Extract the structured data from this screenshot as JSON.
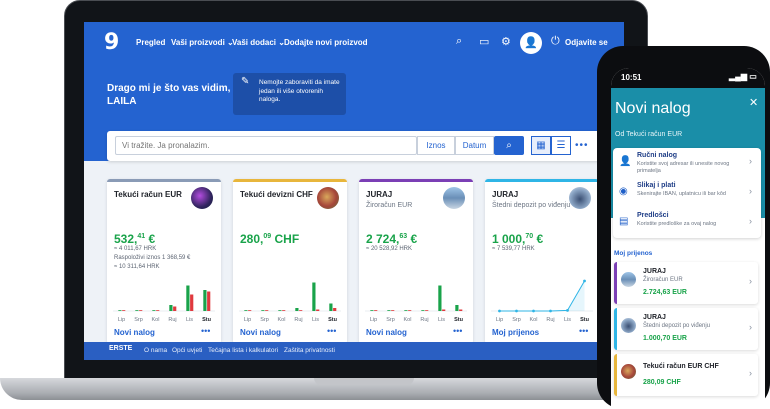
{
  "colors": {
    "brand_blue": "#2463d0",
    "green": "#19a34a",
    "phone_accent": "#1a8ea8",
    "red": "#e0393e"
  },
  "nav": {
    "logo": "9",
    "items": [
      "Pregled",
      "Vaši proizvodi",
      "Vaši dodaci",
      "Dodajte novi proizvod"
    ],
    "logout": "Odjavite se",
    "icons": [
      "search-icon",
      "chat-icon",
      "gear-icon",
      "user-icon",
      "power-icon"
    ]
  },
  "hero": {
    "greeting": "Drago mi je što vas vidim, LAILA",
    "notice": "Nemojte zaboraviti da imate jedan ili više otvorenih naloga."
  },
  "search": {
    "placeholder": "Vi tražite. Ja pronalazim.",
    "filters": [
      "Iznos",
      "Datum"
    ]
  },
  "cards": [
    {
      "title": "Tekući račun EUR",
      "subtitle": "",
      "balance_int": "532,",
      "balance_dec": "41",
      "currency": "€",
      "lines": [
        "≈ 4 011,67 HRK",
        "Raspoloživi iznos 1 368,59 €",
        "≈ 10 311,64 HRK"
      ],
      "action": "Novi nalog",
      "accent": "#8a9bb6",
      "chart_data": {
        "type": "bar",
        "categories": [
          "Lip",
          "Srp",
          "Kol",
          "Ruj",
          "Lis",
          "Stu"
        ],
        "series": [
          {
            "values": [
              0,
              0,
              0,
              0.2,
              0.85,
              0.7
            ],
            "color": "#19a34a"
          },
          {
            "values": [
              0,
              0,
              0,
              0.15,
              0.55,
              0.65
            ],
            "color": "#e0393e"
          }
        ]
      }
    },
    {
      "title": "Tekući devizni CHF",
      "subtitle": "",
      "balance_int": "280,",
      "balance_dec": "09",
      "currency": "CHF",
      "lines": [],
      "action": "Novi nalog",
      "accent": "#e8b63c",
      "chart_data": {
        "type": "bar",
        "categories": [
          "Lip",
          "Srp",
          "Kol",
          "Ruj",
          "Lis",
          "Stu"
        ],
        "series": [
          {
            "values": [
              0,
              0,
              0,
              0.1,
              0.95,
              0.25
            ],
            "color": "#19a34a"
          },
          {
            "values": [
              0,
              0,
              0,
              0,
              0.05,
              0.1
            ],
            "color": "#e0393e"
          }
        ]
      }
    },
    {
      "title": "JURAJ",
      "subtitle": "Žiroračun EUR",
      "balance_int": "2 724,",
      "balance_dec": "63",
      "currency": "€",
      "lines": [
        "≈ 20 528,92 HRK"
      ],
      "action": "Novi nalog",
      "accent": "#7b3fb5",
      "chart_data": {
        "type": "bar",
        "categories": [
          "Lip",
          "Srp",
          "Kol",
          "Ruj",
          "Lis",
          "Stu"
        ],
        "series": [
          {
            "values": [
              0,
              0,
              0,
              0,
              0.85,
              0.2
            ],
            "color": "#19a34a"
          },
          {
            "values": [
              0,
              0,
              0,
              0,
              0.05,
              0.05
            ],
            "color": "#e0393e"
          }
        ]
      }
    },
    {
      "title": "JURAJ",
      "subtitle": "Štedni depozit po viđenju",
      "balance_int": "1 000,",
      "balance_dec": "70",
      "currency": "€",
      "lines": [
        "≈ 7 539,77 HRK"
      ],
      "action": "Moj prijenos",
      "accent": "#2fb5e6",
      "chart_data": {
        "type": "line",
        "categories": [
          "Lip",
          "Srp",
          "Kol",
          "Ruj",
          "Lis",
          "Stu"
        ],
        "values": [
          0,
          0,
          0,
          0,
          0.02,
          1
        ]
      }
    }
  ],
  "footer": {
    "brand": "ERSTE",
    "links": [
      "O nama",
      "Opći uvjeti",
      "Tečajna lista i kalkulatori",
      "Zaštita privatnosti"
    ]
  },
  "phone": {
    "time": "10:51",
    "title": "Novi nalog",
    "from": "Od Tekući račun EUR",
    "options": [
      {
        "title": "Ručni nalog",
        "desc": "Koristite svoj adresar ili unesite novog primatelja",
        "icon": "user-icon"
      },
      {
        "title": "Slikaj i plati",
        "desc": "Skenirajte IBAN, uplatnicu ili bar kôd",
        "icon": "camera-icon"
      },
      {
        "title": "Predlošci",
        "desc": "Koristite predloške za ovaj nalog",
        "icon": "template-icon"
      }
    ],
    "section": "Moj prijenos",
    "transfers": [
      {
        "title": "JURAJ",
        "sub": "Žiroračun EUR",
        "amount": "2.724,63 EUR",
        "color": "#7b3fb5"
      },
      {
        "title": "JURAJ",
        "sub": "Štedni depozit po viđenju",
        "amount": "1.000,70 EUR",
        "color": "#2fb5e6"
      },
      {
        "title": "Tekući račun EUR CHF",
        "sub": "",
        "amount": "280,09 CHF",
        "color": "#e8b63c"
      }
    ]
  }
}
